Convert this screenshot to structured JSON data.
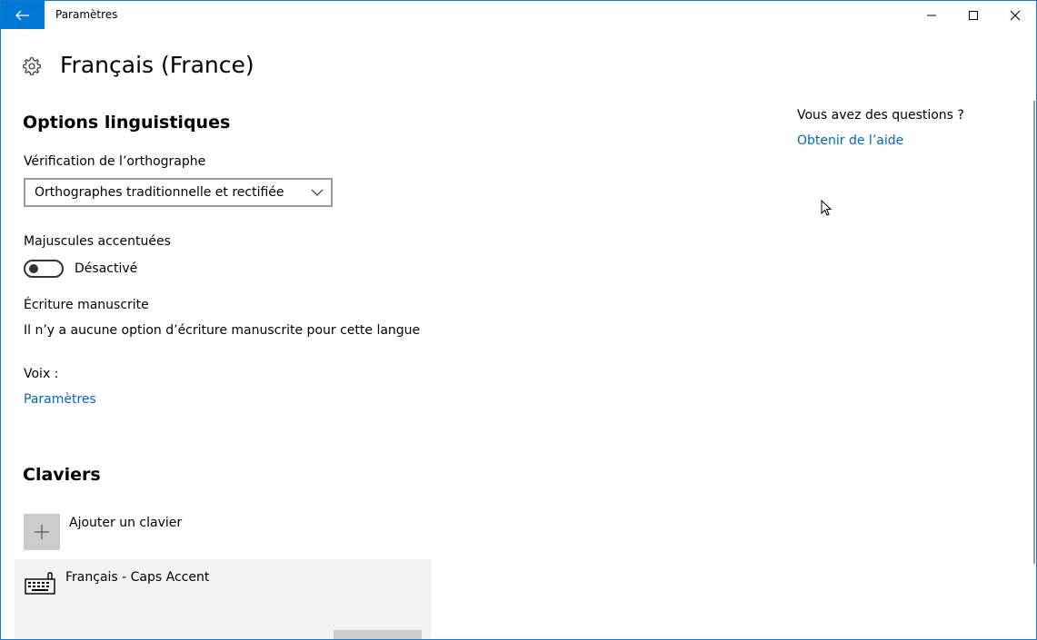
{
  "window": {
    "title": "Paramètres",
    "accent": "#0078d7"
  },
  "header": {
    "title": "Français (France)"
  },
  "language_options": {
    "heading": "Options linguistiques",
    "spellcheck_label": "Vérification de l’orthographe",
    "spellcheck_value": "Orthographes traditionnelle et rectifiée",
    "accented_caps_label": "Majuscules accentuées",
    "accented_caps_state": "Désactivé",
    "accented_caps_on": false,
    "handwriting_label": "Écriture manuscrite",
    "handwriting_text": "Il n’y a aucune option d’écriture manuscrite pour cette langue",
    "voice_label": "Voix :",
    "voice_link": "Paramètres"
  },
  "keyboards": {
    "heading": "Claviers",
    "add_label": "Ajouter un clavier",
    "items": [
      {
        "label": "Français - Caps Accent"
      }
    ]
  },
  "help": {
    "question": "Vous avez des questions ?",
    "link": "Obtenir de l’aide"
  }
}
